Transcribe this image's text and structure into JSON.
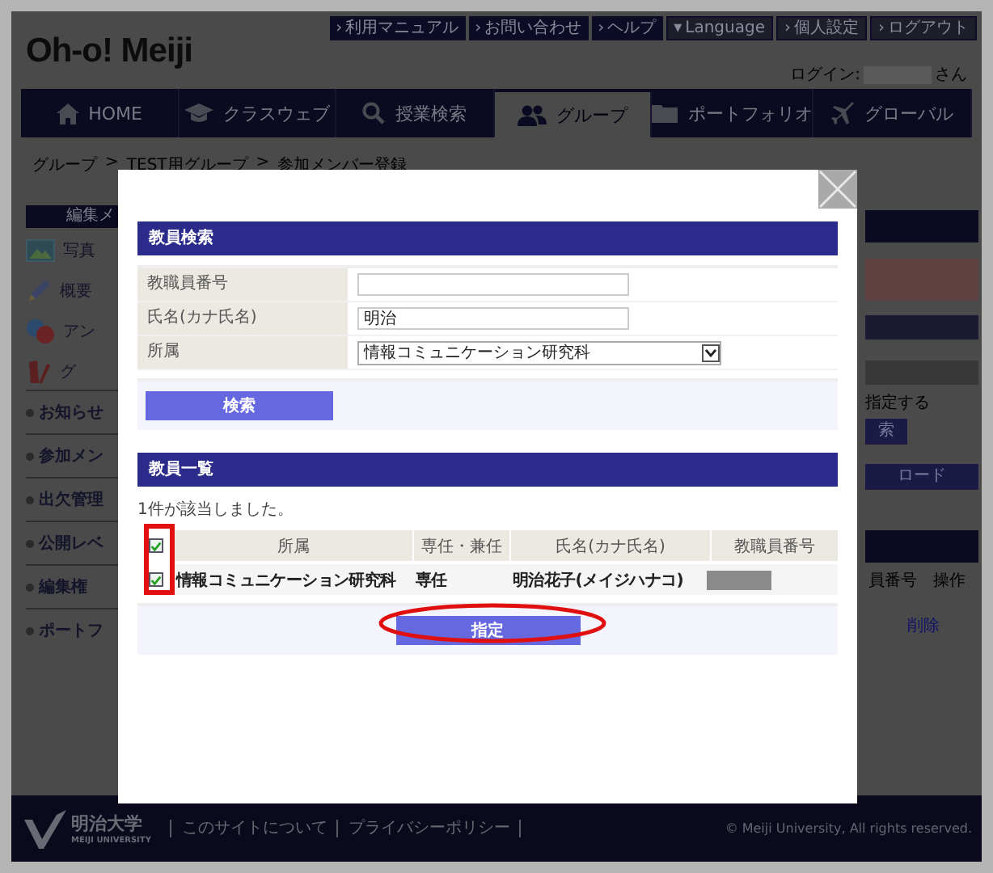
{
  "header": {
    "logo": "Oh-o! Meiji",
    "top_links": [
      {
        "marker": "›",
        "label": "利用マニュアル",
        "kind": "dark"
      },
      {
        "marker": "›",
        "label": "お問い合わせ",
        "kind": "dark"
      },
      {
        "marker": "›",
        "label": "ヘルプ",
        "kind": "dark"
      },
      {
        "marker": "▾",
        "label": "Language",
        "kind": "light"
      },
      {
        "marker": "›",
        "label": "個人設定",
        "kind": "light"
      },
      {
        "marker": "›",
        "label": "ログアウト",
        "kind": "light"
      }
    ],
    "login": {
      "label": "ログイン:",
      "suffix": "さん"
    }
  },
  "nav": [
    {
      "label": "HOME",
      "kind": "home",
      "selected": false
    },
    {
      "label": "クラスウェブ",
      "kind": "cap",
      "selected": false
    },
    {
      "label": "授業検索",
      "kind": "search",
      "selected": false
    },
    {
      "label": "グループ",
      "kind": "people",
      "selected": true
    },
    {
      "label": "ポートフォリオ",
      "kind": "folder",
      "selected": false
    },
    {
      "label": "グローバル",
      "kind": "plane",
      "selected": false
    }
  ],
  "breadcrumb": {
    "separator": ">",
    "items": [
      "グループ",
      "TEST用グループ",
      "参加メンバー登録"
    ]
  },
  "sidebar": {
    "title": "編集メ",
    "icon_items": [
      {
        "label": "写真",
        "kind": "photo"
      },
      {
        "label": "概要",
        "kind": "pencil"
      },
      {
        "label": "アン",
        "kind": "qa"
      },
      {
        "label": "グ",
        "kind": "book"
      }
    ],
    "items": [
      "お知らせ",
      "参加メン",
      "出欠管理",
      "公開レベ",
      "編集権",
      "ポートフ"
    ]
  },
  "right_panel": {
    "note": "指定する",
    "buttons": [
      "索",
      "ロード"
    ],
    "columns": [
      "員番号",
      "操作"
    ],
    "row_action": "削除"
  },
  "modal": {
    "search": {
      "title": "教員検索",
      "fields": [
        {
          "label": "教職員番号",
          "kind": "text"
        },
        {
          "label": "氏名(カナ氏名)",
          "kind": "text",
          "value": "明治"
        },
        {
          "label": "所属",
          "kind": "select",
          "value": "情報コミュニケーション研究科"
        }
      ],
      "button": "検索"
    },
    "results": {
      "title": "教員一覧",
      "count_text": "1件が該当しました。",
      "header_checked": true,
      "columns": [
        "所属",
        "専任・兼任",
        "氏名(カナ氏名)",
        "教職員番号"
      ],
      "rows": [
        {
          "checked": true,
          "cells": [
            "情報コミュニケーション研究科",
            "専任",
            "明治花子(メイジハナコ)"
          ]
        }
      ]
    },
    "submit_button": "指定"
  },
  "footer": {
    "logo_name": "明治大学",
    "logo_sub": "MEIJI UNIVERSITY",
    "links": [
      "このサイトについて",
      "プライバシーポリシー"
    ],
    "copyright": "© Meiji University, All rights reserved."
  }
}
